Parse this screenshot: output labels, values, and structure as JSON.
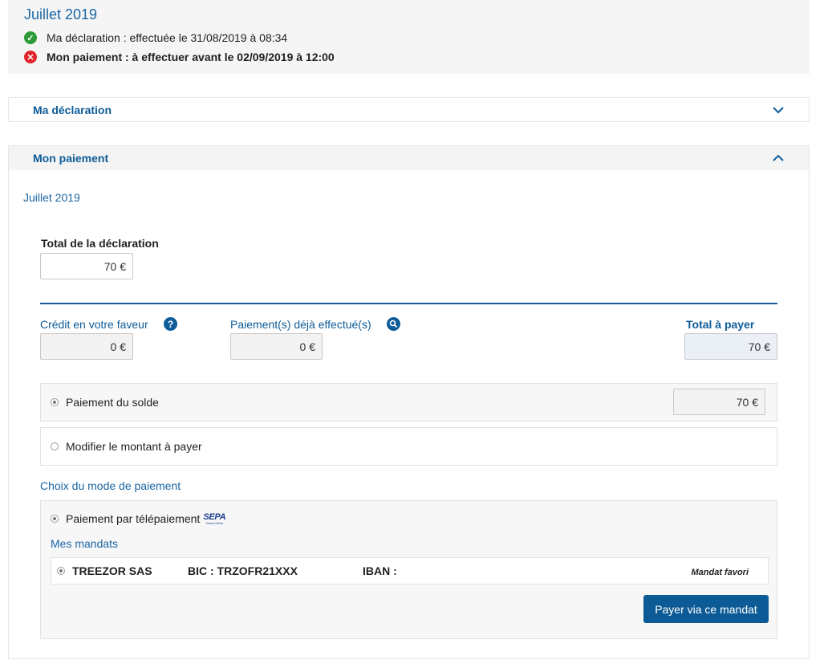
{
  "summary": {
    "period": "Juillet 2019",
    "declaration_status": "Ma déclaration : effectuée le 31/08/2019 à 08:34",
    "payment_status": "Mon paiement : à effectuer avant le 02/09/2019 à 12:00"
  },
  "accordion_declaration": {
    "title": "Ma déclaration"
  },
  "accordion_payment": {
    "title": "Mon paiement",
    "period": "Juillet 2019",
    "total_declaration": {
      "label": "Total de la déclaration",
      "value": "70 €"
    },
    "credit": {
      "label": "Crédit en votre faveur",
      "value": "0 €"
    },
    "payments_done": {
      "label": "Paiement(s) déjà effectué(s)",
      "value": "0 €"
    },
    "total_to_pay": {
      "label": "Total à payer",
      "value": "70 €"
    },
    "options": {
      "balance": {
        "label": "Paiement du solde",
        "value": "70 €",
        "selected": true
      },
      "modify": {
        "label": "Modifier le montant à payer",
        "selected": false
      }
    },
    "payment_mode": {
      "title": "Choix du mode de paiement",
      "teleprocessing_label": "Paiement par télépaiement",
      "sepa_logo": {
        "main": "SEPA",
        "sub": "Direct Debit"
      },
      "mandates_title": "Mes mandats",
      "mandate": {
        "name": "TREEZOR SAS",
        "bic": "BIC : TRZOFR21XXX",
        "iban": "IBAN :",
        "favorite": "Mandat favori"
      },
      "pay_button": "Payer via ce mandat"
    }
  },
  "colors": {
    "primary_blue": "#0e5c98",
    "success_green": "#2e9b3a",
    "error_red": "#e0242b"
  }
}
